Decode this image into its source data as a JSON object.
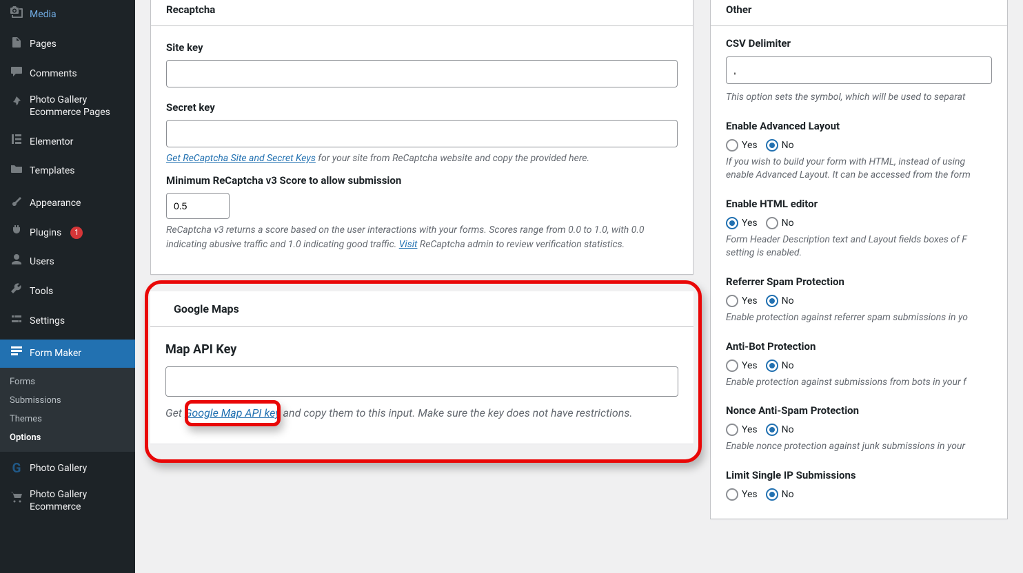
{
  "sidebar": {
    "items": [
      {
        "label": "Media"
      },
      {
        "label": "Pages"
      },
      {
        "label": "Comments"
      },
      {
        "label": "Photo Gallery Ecommerce Pages"
      },
      {
        "label": "Elementor"
      },
      {
        "label": "Templates"
      },
      {
        "label": "Appearance"
      },
      {
        "label": "Plugins",
        "badge": "1"
      },
      {
        "label": "Users"
      },
      {
        "label": "Tools"
      },
      {
        "label": "Settings"
      },
      {
        "label": "Form Maker"
      },
      {
        "label": "Photo Gallery"
      },
      {
        "label": "Photo Gallery Ecommerce"
      }
    ],
    "sub": [
      {
        "label": "Forms"
      },
      {
        "label": "Submissions"
      },
      {
        "label": "Themes"
      },
      {
        "label": "Options"
      }
    ]
  },
  "recaptcha": {
    "title": "Recaptcha",
    "site_key_label": "Site key",
    "site_key_value": "",
    "secret_key_label": "Secret key",
    "secret_key_value": "",
    "keys_link": "Get ReCaptcha Site and Secret Keys",
    "keys_tail": " for your site from ReCaptcha website and copy the provided here.",
    "score_label": "Minimum ReCaptcha v3 Score to allow submission",
    "score_value": "0.5",
    "score_help_pre": "ReCaptcha v3 returns a score based on the user interactions with your forms. Scores range from 0.0 to 1.0, with 0.0 indicating abusive traffic and 1.0 indicating good traffic. ",
    "score_visit": "Visit",
    "score_help_post": " ReCaptcha admin to review verification statistics."
  },
  "gmaps": {
    "title": "Google Maps",
    "api_label": "Map API Key",
    "api_value": "",
    "help_pre": "Get ",
    "help_link": "Google Map API key",
    "help_post": " and copy them to this input. Make sure the key does not have restrictions."
  },
  "other": {
    "title": "Other",
    "csv_label": "CSV Delimiter",
    "csv_value": ",",
    "csv_help": "This option sets the symbol, which will be used to separat",
    "adv_label": "Enable Advanced Layout",
    "adv_sel": "No",
    "adv_help": "If you wish to build your form with HTML, instead of using enable Advanced Layout. It can be accessed from the form",
    "html_label": "Enable HTML editor",
    "html_sel": "Yes",
    "html_help": "Form Header Description text and Layout fields boxes of F setting is enabled.",
    "ref_label": "Referrer Spam Protection",
    "ref_sel": "No",
    "ref_help": "Enable protection against referrer spam submissions in yo",
    "anti_label": "Anti-Bot Protection",
    "anti_sel": "No",
    "anti_help": "Enable protection against submissions from bots in your f",
    "nonce_label": "Nonce Anti-Spam Protection",
    "nonce_sel": "No",
    "nonce_help": "Enable nonce protection against junk submissions in your",
    "ip_label": "Limit Single IP Submissions",
    "ip_sel": "No",
    "yes": "Yes",
    "no": "No"
  }
}
